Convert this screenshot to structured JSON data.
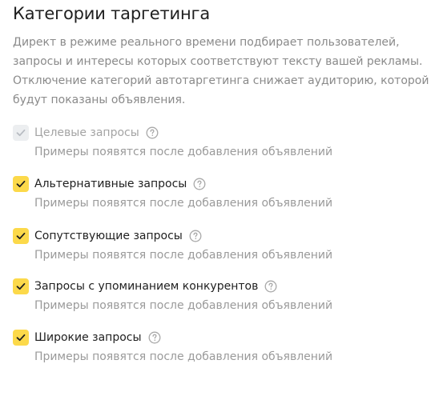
{
  "title": "Категории таргетинга",
  "description": [
    "Директ в режиме реального времени подбирает пользователей,",
    "запросы и интересы которых соответствуют тексту вашей рекламы.",
    "Отключение категорий автотаргетинга снижает аудиторию, которой",
    "будут показаны объявления."
  ],
  "options": [
    {
      "label": "Целевые запросы",
      "hint": "Примеры появятся после добавления объявлений",
      "checked": true,
      "disabled": true
    },
    {
      "label": "Альтернативные запросы",
      "hint": "Примеры появятся после добавления объявлений",
      "checked": true,
      "disabled": false
    },
    {
      "label": "Сопутствующие запросы",
      "hint": "Примеры появятся после добавления объявлений",
      "checked": true,
      "disabled": false
    },
    {
      "label": "Запросы с упоминанием конкурентов",
      "hint": "Примеры появятся после добавления объявлений",
      "checked": true,
      "disabled": false
    },
    {
      "label": "Широкие запросы",
      "hint": "Примеры появятся после добавления объявлений",
      "checked": true,
      "disabled": false
    }
  ],
  "icons": {
    "check": "check-icon",
    "help": "question-circle-icon"
  },
  "colors": {
    "checkbox_active": "#fcd94a",
    "checkbox_disabled": "#eceef0",
    "text_primary": "#1f1f1f",
    "text_secondary": "#8a8a8a"
  }
}
